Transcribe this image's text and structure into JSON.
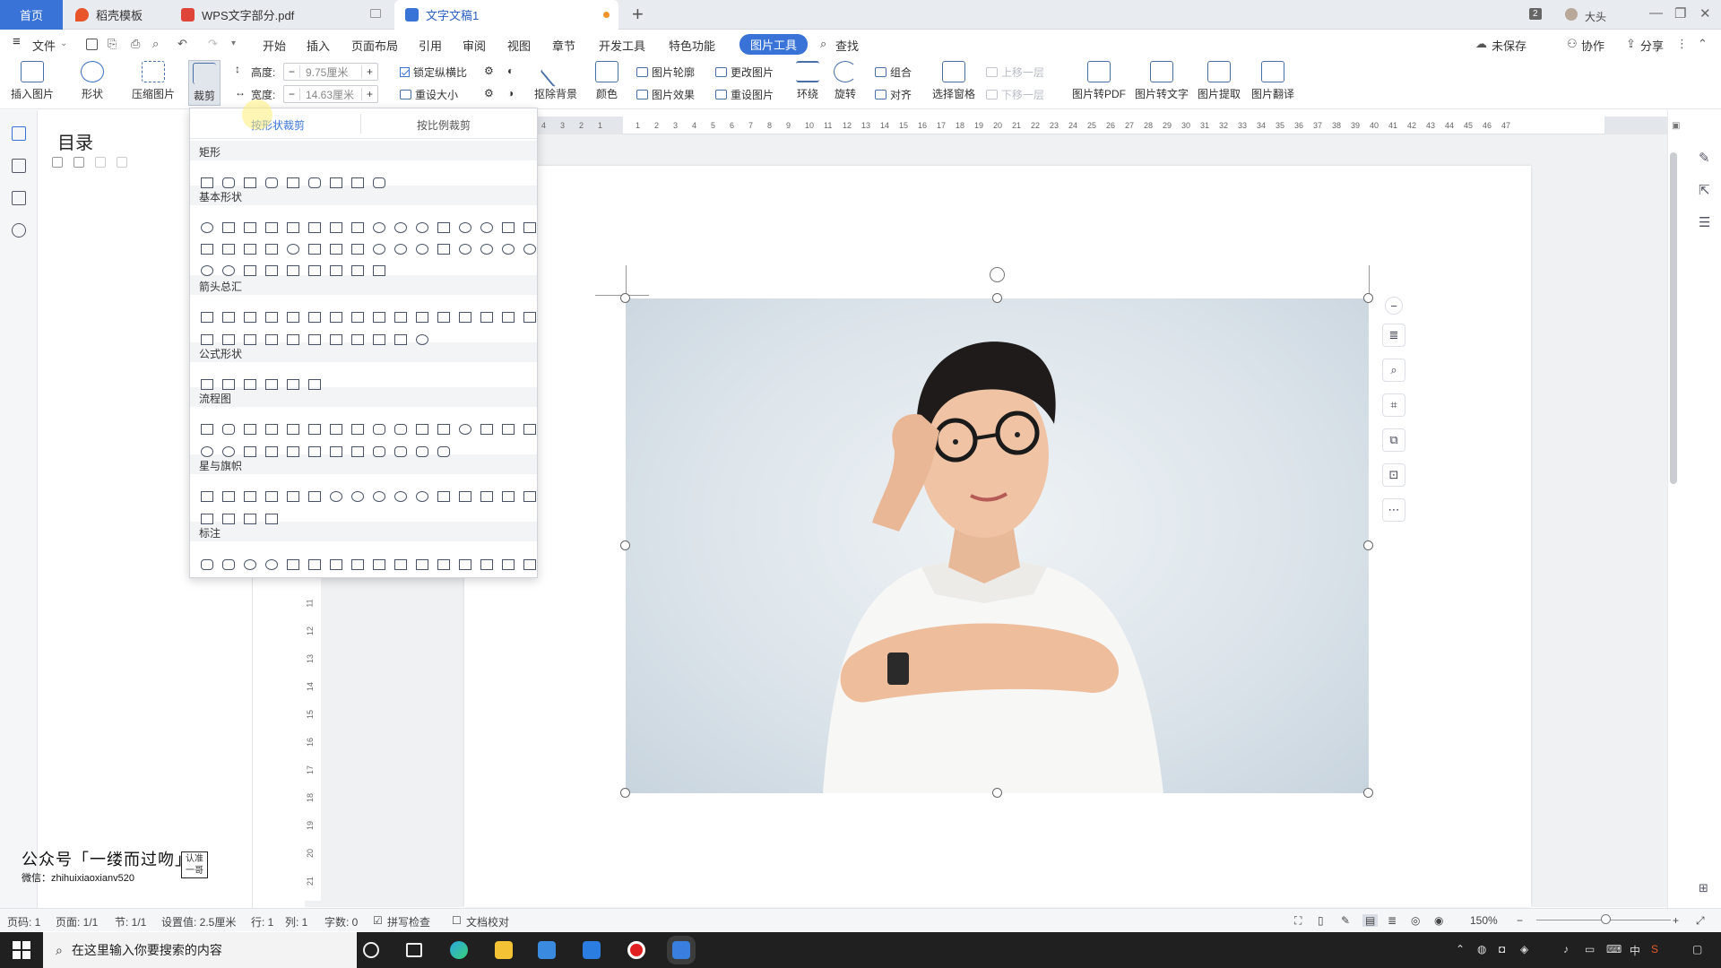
{
  "tabs": {
    "home": "首页",
    "templates": "稻壳模板",
    "pdf": "WPS文字部分.pdf",
    "doc": "文字文稿1",
    "new_tab": "+"
  },
  "titlebar": {
    "window_count": "2",
    "user": "大头"
  },
  "menu": {
    "file": "文件",
    "items": [
      "开始",
      "插入",
      "页面布局",
      "引用",
      "审阅",
      "视图",
      "章节",
      "开发工具",
      "特色功能"
    ],
    "active_tab": "图片工具",
    "search": "查找",
    "unsaved": "未保存",
    "collab": "协作",
    "share": "分享"
  },
  "ribbon": {
    "insert_picture": "插入图片",
    "shapes": "形状",
    "compress": "压缩图片",
    "crop": "裁剪",
    "height_label": "高度:",
    "height_value": "9.75厘米",
    "width_label": "宽度:",
    "width_value": "14.63厘米",
    "lock_ratio": "锁定纵横比",
    "reset_size": "重设大小",
    "remove_bg": "抠除背景",
    "color": "颜色",
    "outline": "图片轮廓",
    "effects": "图片效果",
    "change_pic": "更改图片",
    "reset_pic": "重设图片",
    "wrap": "环绕",
    "rotate": "旋转",
    "group": "组合",
    "align": "对齐",
    "select_pane": "选择窗格",
    "bring_forward": "上移一层",
    "send_backward": "下移一层",
    "to_pdf": "图片转PDF",
    "to_text": "图片转文字",
    "extract": "图片提取",
    "translate": "图片翻译"
  },
  "outline": {
    "title": "目录"
  },
  "crop_menu": {
    "tab_shape": "按形状裁剪",
    "tab_ratio": "按比例裁剪",
    "categories": [
      "矩形",
      "基本形状",
      "箭头总汇",
      "公式形状",
      "流程图",
      "星与旗帜",
      "标注"
    ]
  },
  "hruler_labels": [
    "4",
    "3",
    "2",
    "1",
    "",
    "1",
    "2",
    "3",
    "4",
    "5",
    "6",
    "7",
    "8",
    "9",
    "10",
    "11",
    "12",
    "13",
    "14",
    "15",
    "16",
    "17",
    "18",
    "19",
    "20",
    "21",
    "22",
    "23",
    "24",
    "25",
    "26",
    "27",
    "28",
    "29",
    "30",
    "31",
    "32",
    "33",
    "34",
    "35",
    "36",
    "37",
    "38",
    "39",
    "40",
    "41",
    "42",
    "43",
    "44",
    "45",
    "46",
    "47"
  ],
  "vruler_labels": [
    "11",
    "12",
    "13",
    "14",
    "15",
    "16",
    "17",
    "18",
    "19",
    "20",
    "21"
  ],
  "watermark": {
    "line1": "公众号「一缕而过吻」",
    "line2": "微信：zhihuixiaoxianv520",
    "stamp": "认准一哥"
  },
  "statusbar": {
    "page_code": "页码: 1",
    "pages": "页面: 1/1",
    "section": "节: 1/1",
    "setting": "设置值: 2.5厘米",
    "row": "行: 1",
    "col": "列: 1",
    "words": "字数: 0",
    "spell": "拼写检查",
    "proof": "文档校对",
    "zoom": "150%"
  },
  "taskbar": {
    "search_placeholder": "在这里输入你要搜索的内容",
    "ime": "中"
  },
  "colors": {
    "accent": "#3973d8",
    "ribbon_icon": "#4a6fa8",
    "taskbar": "#202020"
  }
}
